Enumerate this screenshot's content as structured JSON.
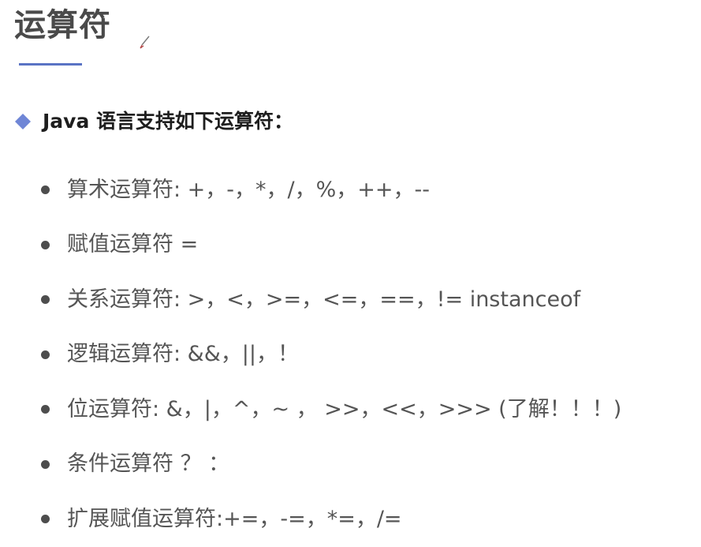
{
  "slide": {
    "title": "运算符",
    "accent_color": "#5a73c4",
    "section_heading": "Java 语言支持如下运算符：",
    "items": [
      "算术运算符: +，-，*，/，%，++，--",
      "赋值运算符 =",
      "关系运算符: >，<，>=，<=，==，!= instanceof",
      "逻辑运算符: &&，||，！",
      "位运算符: &，|，^，~ ， >>，<<，>>> (了解！！！)",
      "条件运算符 ？ ：",
      "扩展赋值运算符:+=，-=，*=，/="
    ]
  }
}
